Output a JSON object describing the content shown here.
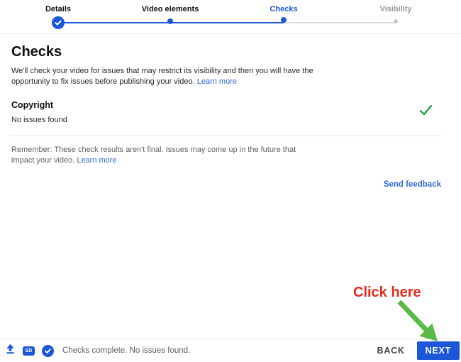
{
  "stepper": {
    "steps": [
      {
        "label": "Details",
        "state": "completed"
      },
      {
        "label": "Video elements",
        "state": "completed"
      },
      {
        "label": "Checks",
        "state": "active"
      },
      {
        "label": "Visibility",
        "state": "upcoming"
      }
    ]
  },
  "content": {
    "title": "Checks",
    "description": "We'll check your video for issues that may restrict its visibility and then you will have the opportunity to fix issues before publishing your video.",
    "description_link": "Learn more",
    "copyright": {
      "label": "Copyright",
      "status": "No issues found",
      "result_icon": "green-check"
    },
    "reminder": "Remember: These check results aren't final. Issues may come up in the future that impact your video.",
    "reminder_link": "Learn more",
    "send_feedback": "Send feedback"
  },
  "footer": {
    "status": "Checks complete. No issues found.",
    "sd_badge": "SD",
    "back_label": "BACK",
    "next_label": "NEXT"
  },
  "annotation": {
    "text": "Click here"
  },
  "colors": {
    "primary_blue": "#1b57d6",
    "link_blue": "#2e69dc",
    "success_green": "#149d43",
    "annotation_red": "#e32a1d",
    "annotation_green": "#58b947",
    "text_primary": "#0f0f0f",
    "text_secondary": "#606060"
  }
}
